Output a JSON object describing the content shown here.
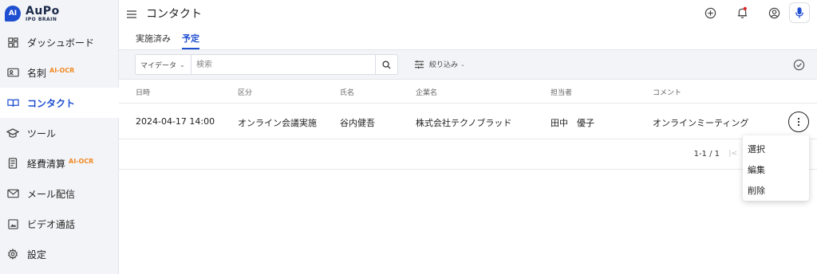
{
  "app": {
    "logo_badge": "AI",
    "logo_name": "AuPo",
    "logo_sub": "IPO BRAIN"
  },
  "sidebar": {
    "items": [
      {
        "label": "ダッシュボード",
        "icon": "dashboard-icon",
        "badge": ""
      },
      {
        "label": "名刺",
        "icon": "business-card-icon",
        "badge": "AI-OCR"
      },
      {
        "label": "コンタクト",
        "icon": "book-icon",
        "badge": "",
        "active": true
      },
      {
        "label": "ツール",
        "icon": "graduation-cap-icon",
        "badge": ""
      },
      {
        "label": "経費清算",
        "icon": "receipt-icon",
        "badge": "AI-OCR"
      },
      {
        "label": "メール配信",
        "icon": "mail-icon",
        "badge": ""
      },
      {
        "label": "ビデオ通話",
        "icon": "image-icon",
        "badge": ""
      },
      {
        "label": "設定",
        "icon": "gear-icon",
        "badge": ""
      }
    ]
  },
  "header": {
    "title": "コンタクト"
  },
  "tabs": [
    {
      "label": "実施済み",
      "active": false
    },
    {
      "label": "予定",
      "active": true
    }
  ],
  "filters": {
    "data_select": "マイデータ",
    "search_placeholder": "検索",
    "filter_label": "絞り込み"
  },
  "table": {
    "headers": [
      "日時",
      "区分",
      "氏名",
      "企業名",
      "担当者",
      "コメント"
    ],
    "rows": [
      {
        "datetime": "2024-04-17 14:00",
        "category": "オンライン会議実施",
        "name": "谷内健吾",
        "company": "株式会社テクノブラッド",
        "owner": "田中　優子",
        "comment": "オンラインミーティング"
      }
    ]
  },
  "pagination": {
    "range": "1-1 / 1",
    "first_symbol": "|<"
  },
  "row_menu": {
    "items": [
      "選択",
      "編集",
      "削除"
    ]
  },
  "colors": {
    "accent": "#1f4fd1",
    "badge": "#f08a24",
    "sidebar_bg": "#f3f4f7",
    "notification_dot": "#e02020"
  }
}
